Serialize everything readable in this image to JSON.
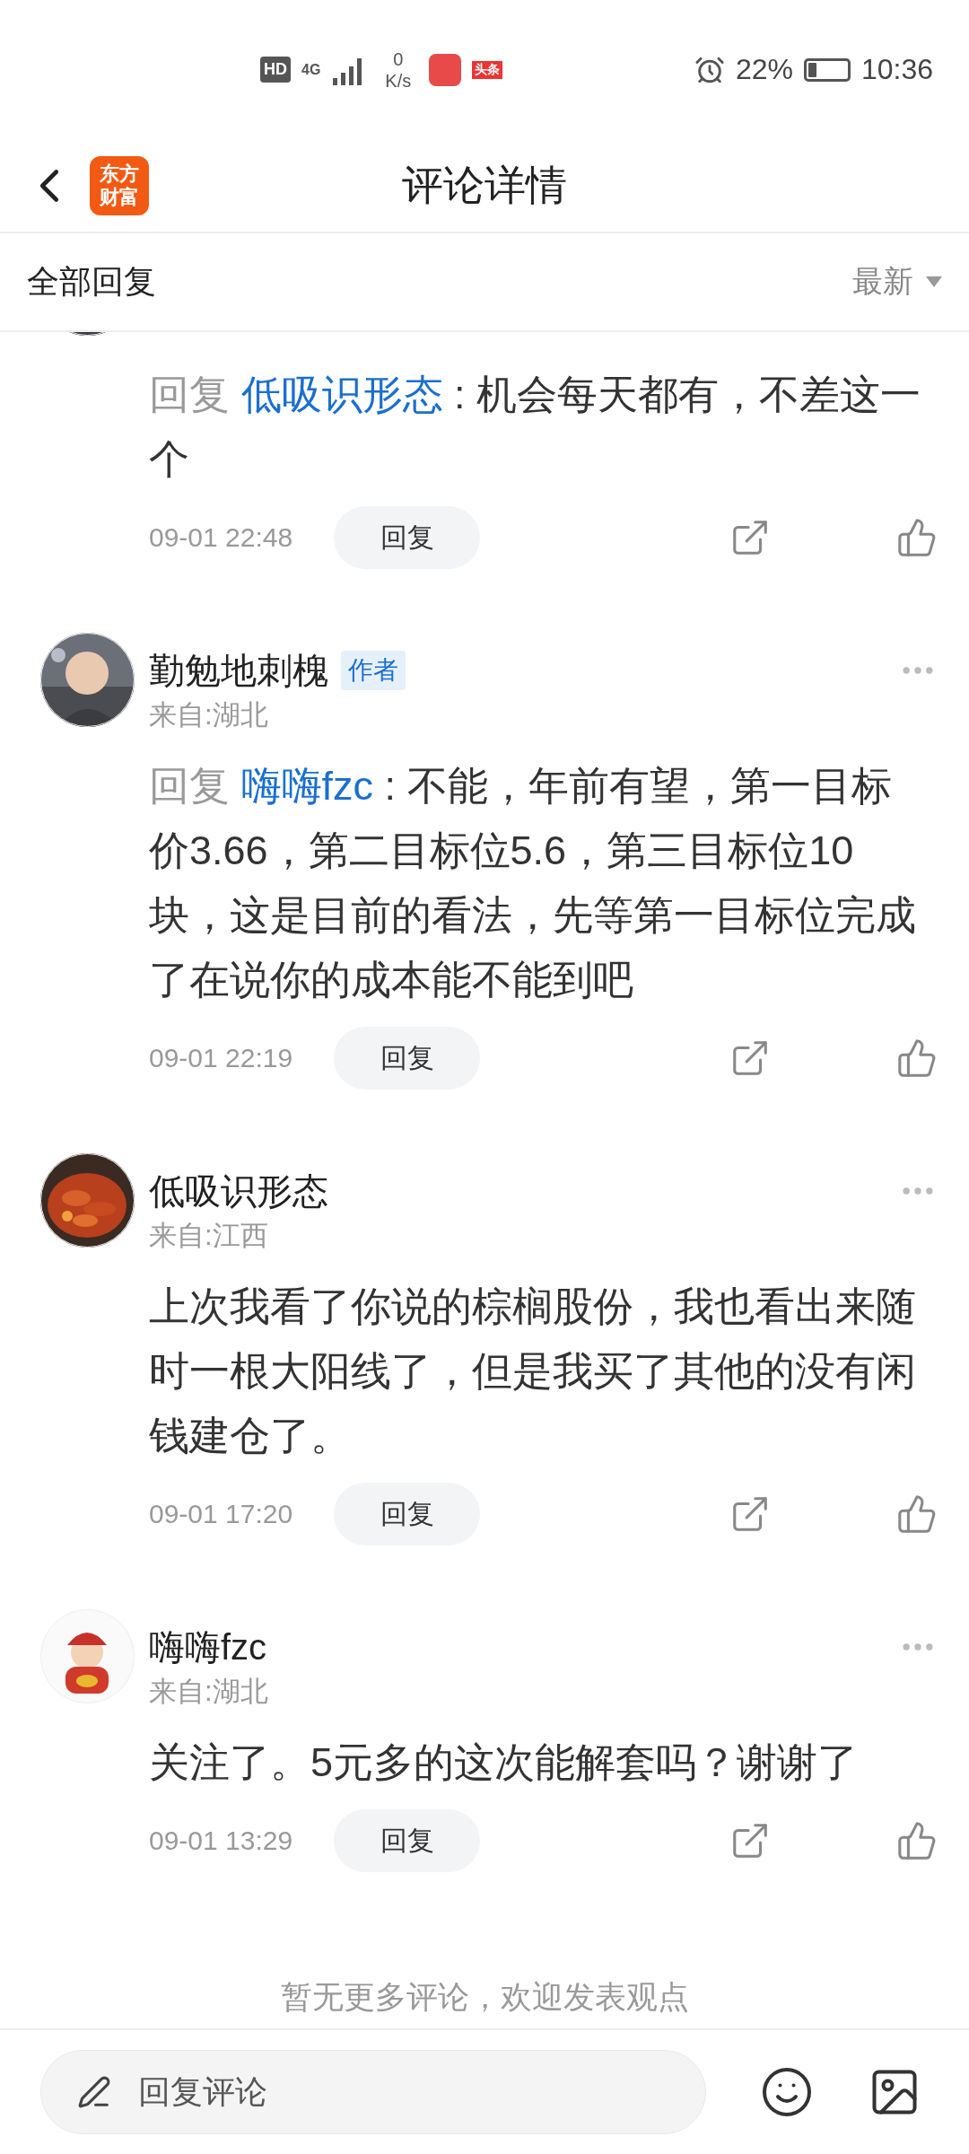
{
  "status_bar": {
    "hd": "HD",
    "network": "4G",
    "speed_value": "0",
    "speed_unit": "K/s",
    "news_badge": "头条",
    "battery_text": "22%",
    "time": "10:36"
  },
  "header": {
    "logo_lines": [
      "东方",
      "财富"
    ],
    "title": "评论详情"
  },
  "filter": {
    "label": "全部回复",
    "sort": "最新"
  },
  "comments": [
    {
      "reply_label": "回复",
      "reply_to": "低吸识形态",
      "text": " : 机会每天都有，不差这一个",
      "time": "09-01 22:48",
      "reply_button": "回复"
    },
    {
      "name": "勤勉地刺槐",
      "author": true,
      "author_label": "作者",
      "location": "来自:湖北",
      "reply_label": "回复",
      "reply_to": "嗨嗨fzc",
      "text": " : 不能，年前有望，第一目标价3.66，第二目标位5.6，第三目标位10块，这是目前的看法，先等第一目标位完成了在说你的成本能不能到吧",
      "time": "09-01 22:19",
      "reply_button": "回复"
    },
    {
      "name": "低吸识形态",
      "author": false,
      "location": "来自:江西",
      "text": "上次我看了你说的棕榈股份，我也看出来随时一根大阳线了，但是我买了其他的没有闲钱建仓了。",
      "time": "09-01 17:20",
      "reply_button": "回复"
    },
    {
      "name": "嗨嗨fzc",
      "author": false,
      "location": "来自:湖北",
      "text": "关注了。5元多的这次能解套吗？谢谢了",
      "time": "09-01 13:29",
      "reply_button": "回复"
    }
  ],
  "end_note": "暂无更多评论，欢迎发表观点",
  "composer": {
    "placeholder": "回复评论"
  }
}
